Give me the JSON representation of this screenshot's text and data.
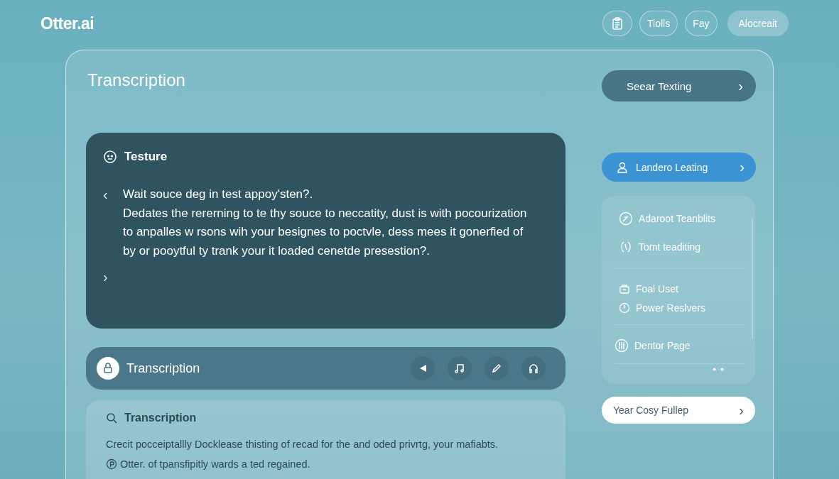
{
  "header": {
    "logo": "Otter.ai",
    "nav": [
      {
        "label": "Tiolls"
      },
      {
        "label": "Fay"
      }
    ],
    "account_button": "Alocreait"
  },
  "main": {
    "title": "Transcription",
    "search_button": {
      "label": "Seear Texting",
      "chevron": "›"
    },
    "question_card": {
      "title": "Testure",
      "prev": "‹",
      "next": "›",
      "question": "Wait souce deg in test appoy'sten?.",
      "answer": "Dedates the rererning to te thy souce to neccatity, dust is with pocourization to anpalles w rsons wih your besignes to poctvle, dess mees it gonerfied of by or pooytful ty trank your it loaded cenetde presestion?."
    },
    "player": {
      "title": "Transcription"
    },
    "transcript": {
      "title": "Transcription",
      "lines": [
        "Crecit pocceiptallly Docklease thisting of recad for the and oded privrtg, your mafiabts.",
        "Otter. of tpansfipitly wards a ted regained."
      ]
    },
    "side": {
      "primary_button": {
        "label": "Landero Leating",
        "chevron": "›"
      },
      "groups": [
        [
          {
            "label": "Adaroot Teanblits"
          },
          {
            "label": "Tomt teaditing"
          }
        ],
        [
          {
            "label": "Foal Uset"
          },
          {
            "label": "Power Reslvers"
          }
        ],
        [
          {
            "label": "Dentor Page"
          }
        ]
      ],
      "bottom_button": {
        "label": "Year Cosy Fullep",
        "chevron": "›"
      }
    }
  }
}
